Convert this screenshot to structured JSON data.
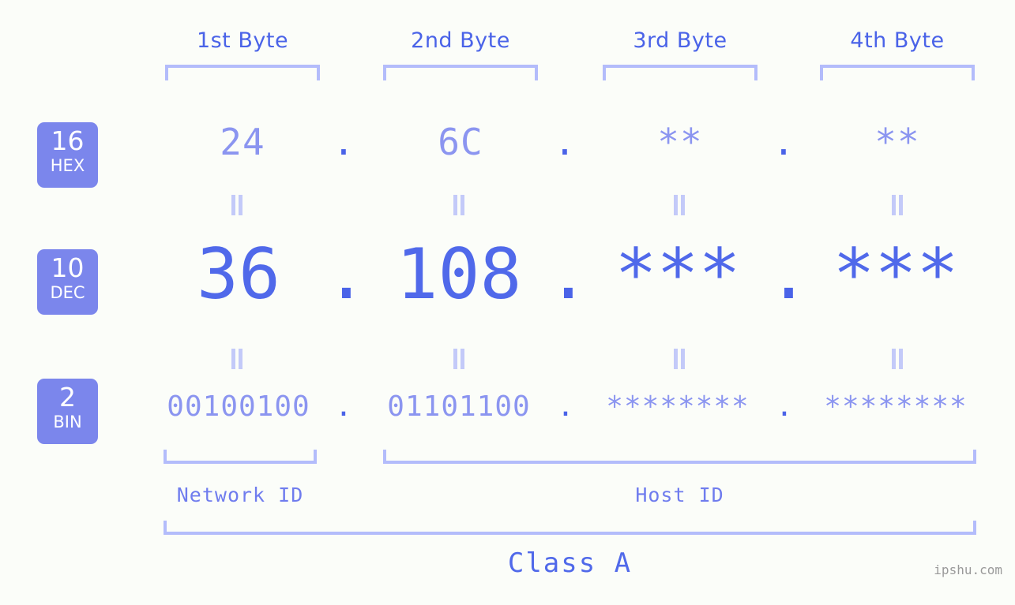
{
  "background_color": "#fbfdf9",
  "colors": {
    "badge_bg": "#7b86ec",
    "badge_text": "#ffffff",
    "bracket": "#b3bcfb",
    "header_text": "#4a63e8",
    "hex_value": "#8b95f0",
    "dec_value": "#5069ea",
    "bin_value": "#8b95f0",
    "eq_mark": "#c3caf9",
    "id_label": "#6f7cee",
    "watermark": "#9a9a9a"
  },
  "byte_headers": [
    {
      "label": "1st Byte"
    },
    {
      "label": "2nd Byte"
    },
    {
      "label": "3rd Byte"
    },
    {
      "label": "4th Byte"
    }
  ],
  "rows": [
    {
      "base_number": "16",
      "base_name": "HEX",
      "values": [
        "24",
        "6C",
        "**",
        "**"
      ],
      "separators": [
        ".",
        ".",
        "."
      ]
    },
    {
      "base_number": "10",
      "base_name": "DEC",
      "values": [
        "36",
        "108",
        "***",
        "***"
      ],
      "separators": [
        ".",
        ".",
        "."
      ]
    },
    {
      "base_number": "2",
      "base_name": "BIN",
      "values": [
        "00100100",
        "01101100",
        "********",
        "********"
      ],
      "separators": [
        ".",
        ".",
        "."
      ]
    }
  ],
  "equality_marks": {
    "glyph": "||",
    "count_per_gap": 4,
    "gaps": 2
  },
  "id_sections": [
    {
      "label": "Network ID"
    },
    {
      "label": "Host ID"
    }
  ],
  "class_label": "Class A",
  "watermark": "ipshu.com"
}
